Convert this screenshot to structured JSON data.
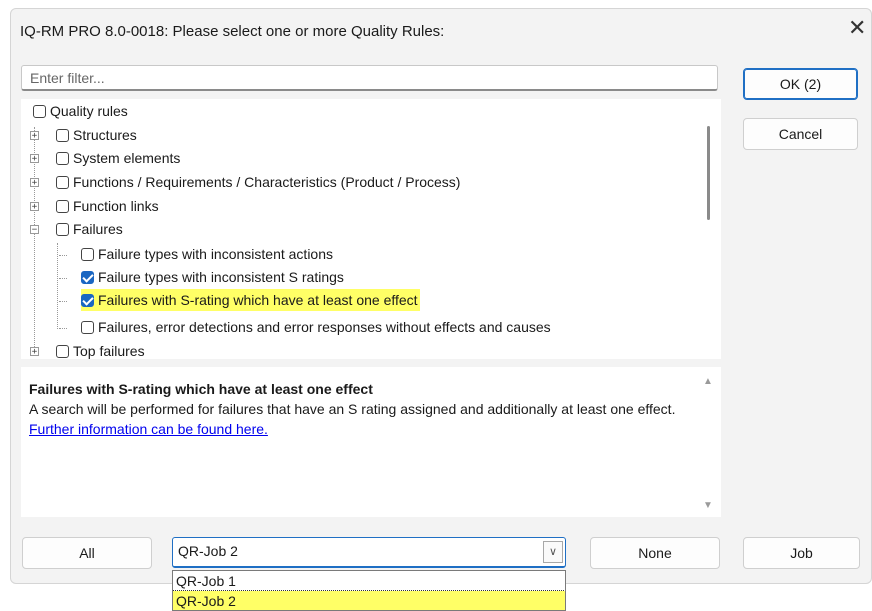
{
  "window": {
    "title": "IQ-RM PRO 8.0-0018: Please select one or more Quality Rules:",
    "close_icon": "close-icon"
  },
  "filter": {
    "placeholder": "Enter filter..."
  },
  "buttons": {
    "ok": "OK (2)",
    "cancel": "Cancel",
    "all": "All",
    "none": "None",
    "job": "Job"
  },
  "tree": {
    "root": "Quality rules",
    "items": [
      {
        "label": "Structures",
        "checked": false
      },
      {
        "label": "System elements",
        "checked": false
      },
      {
        "label": "Functions / Requirements / Characteristics (Product / Process)",
        "checked": false
      },
      {
        "label": "Function links",
        "checked": false
      },
      {
        "label": "Failures",
        "checked": false
      },
      {
        "label": "Failure types with inconsistent actions",
        "checked": false
      },
      {
        "label": "Failure types with inconsistent S ratings",
        "checked": true
      },
      {
        "label": "Failures with S-rating which have at least one effect",
        "checked": true,
        "highlighted": true
      },
      {
        "label": "Failures, error detections and error responses without effects and causes",
        "checked": false
      },
      {
        "label": "Top failures",
        "checked": false
      }
    ]
  },
  "description": {
    "heading": "Failures with S-rating which have at least one effect",
    "body": "A search will be performed for failures that have an S rating assigned and additionally at least one effect.",
    "link": "Further information can be found here."
  },
  "job_select": {
    "value": "QR-Job 2",
    "options": [
      "QR-Job 1",
      "QR-Job 2"
    ],
    "selected_index": 1
  },
  "colors": {
    "highlight": "#ffff66",
    "accent": "#1a66c2",
    "link": "#0000ee"
  }
}
